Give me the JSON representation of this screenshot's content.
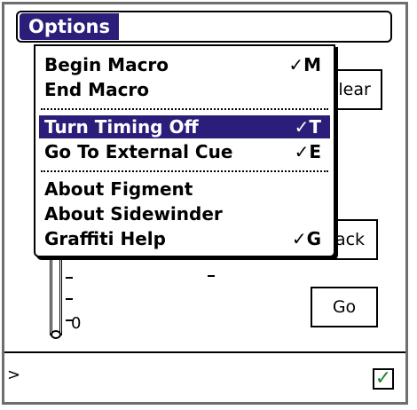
{
  "menubar": {
    "title": "Options"
  },
  "menu": {
    "items": [
      {
        "label": "Begin Macro",
        "shortcut": "✓M",
        "selected": false
      },
      {
        "label": "End Macro",
        "shortcut": "",
        "selected": false
      },
      {
        "label": "Turn Timing Off",
        "shortcut": "✓T",
        "selected": true
      },
      {
        "label": "Go To External Cue",
        "shortcut": "✓E",
        "selected": false
      },
      {
        "label": "About Figment",
        "shortcut": "",
        "selected": false
      },
      {
        "label": "About Sidewinder",
        "shortcut": "",
        "selected": false
      },
      {
        "label": "Graffiti Help",
        "shortcut": "✓G",
        "selected": false
      }
    ]
  },
  "buttons": {
    "clear": "Clear",
    "back": "Back",
    "go": "Go"
  },
  "gauge": {
    "zero_label": "0"
  },
  "input": {
    "prompt": ">"
  },
  "checkbox": {
    "checked_glyph": "✓",
    "checked": true,
    "color": "#1a8a2a"
  },
  "colors": {
    "highlight": "#2a1e7a"
  }
}
